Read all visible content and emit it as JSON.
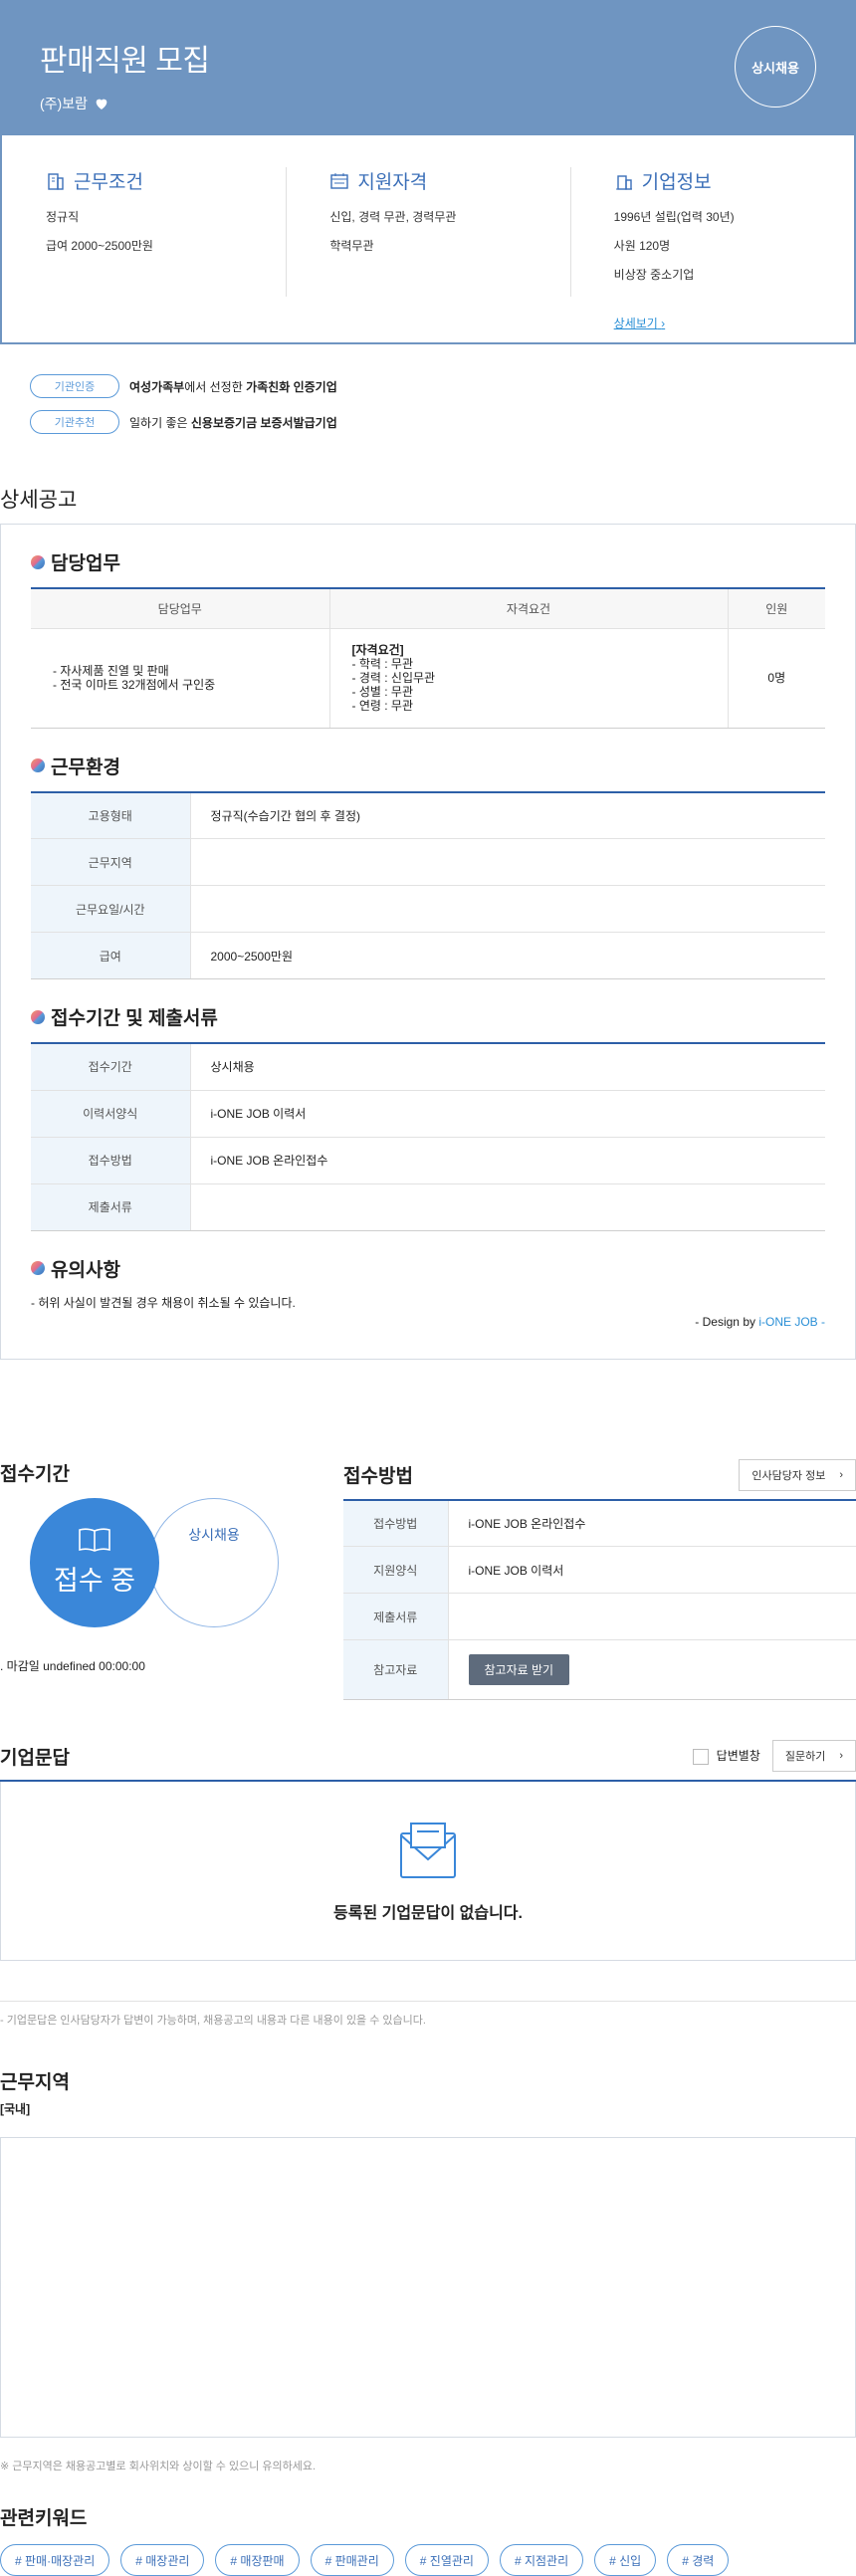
{
  "header": {
    "title": "판매직원 모집",
    "company": "(주)보람",
    "badge": "상시채용"
  },
  "summary": {
    "conditions": {
      "title": "근무조건",
      "lines": [
        "정규직",
        "급여 2000~2500만원"
      ]
    },
    "qualifications": {
      "title": "지원자격",
      "lines": [
        "신입, 경력 무관, 경력무관",
        "학력무관"
      ]
    },
    "company_info": {
      "title": "기업정보",
      "lines": [
        "1996년 설립(업력 30년)",
        "사원 120명",
        "비상장 중소기업"
      ],
      "link": "상세보기"
    }
  },
  "certs": [
    {
      "tag": "기관인증",
      "pre": "여성가족부",
      "mid": "에서 선정한 ",
      "strong": "가족친화 인증기업"
    },
    {
      "tag": "기관추천",
      "pre": "",
      "mid": "일하기 좋은 ",
      "strong": "신용보증기금 보증서발급기업"
    }
  ],
  "detail": {
    "title": "상세공고",
    "duties": {
      "title": "담당업무",
      "headers": [
        "담당업무",
        "자격요건",
        "인원"
      ],
      "task_lines": [
        "- 자사제품 진열 및 판매",
        "- 전국 이마트 32개점에서 구인중"
      ],
      "req_lines": [
        "[자격요건]",
        "- 학력 : 무관",
        "- 경력 : 신입무관",
        "- 성별 : 무관",
        "- 연령 : 무관"
      ],
      "count": "0명"
    },
    "environment": {
      "title": "근무환경",
      "rows": [
        {
          "k": "고용형태",
          "v": "정규직(수습기간 협의 후 결정)"
        },
        {
          "k": "근무지역",
          "v": ""
        },
        {
          "k": "근무요일/시간",
          "v": ""
        },
        {
          "k": "급여",
          "v": "2000~2500만원"
        }
      ]
    },
    "submission": {
      "title": "접수기간 및 제출서류",
      "rows": [
        {
          "k": "접수기간",
          "v": "상시채용"
        },
        {
          "k": "이력서양식",
          "v": "i-ONE JOB 이력서"
        },
        {
          "k": "접수방법",
          "v": "i-ONE JOB 온라인접수"
        },
        {
          "k": "제출서류",
          "v": ""
        }
      ]
    },
    "notes": {
      "title": "유의사항",
      "text": "- 허위 사실이 발견될 경우 채용이 취소될 수 있습니다.",
      "design_pre": "- Design by ",
      "design_brand": "i-ONE JOB -"
    }
  },
  "apply": {
    "period_title": "접수기간",
    "status": "접수 중",
    "type": "상시채용",
    "deadline": "마감일 undefined 00:00:00",
    "method_title": "접수방법",
    "contact_button": "인사담당자 정보",
    "rows": [
      {
        "k": "접수방법",
        "v": "i-ONE JOB 온라인접수"
      },
      {
        "k": "지원양식",
        "v": "i-ONE JOB 이력서"
      },
      {
        "k": "제출서류",
        "v": ""
      },
      {
        "k": "참고자료",
        "v": ""
      }
    ],
    "ref_button": "참고자료 받기"
  },
  "qna": {
    "title": "기업문답",
    "checkbox_label": "답변별창",
    "ask_button": "질문하기",
    "empty": "등록된 기업문답이 없습니다.",
    "note": "- 기업문답은 인사담당자가 답변이 가능하며, 채용공고의 내용과 다른 내용이 있을 수 있습니다."
  },
  "location": {
    "title": "근무지역",
    "sub": "[국내]",
    "note": "※ 근무지역은 채용공고별로 회사위치와 상이할 수 있으니 유의하세요."
  },
  "keywords": {
    "title": "관련키워드",
    "items": [
      "# 판매·매장관리",
      "# 매장관리",
      "# 매장판매",
      "# 판매관리",
      "# 진열관리",
      "# 지점관리",
      "# 신입",
      "# 경력"
    ]
  },
  "colors": {
    "header_bg": "#6f95c1",
    "accent": "#3b6fb8",
    "status_blue": "#3a87d9"
  },
  "icons": [
    "heart-icon",
    "building-icon",
    "form-icon",
    "office-icon",
    "chevron-right-icon",
    "book-icon",
    "mail-icon"
  ]
}
